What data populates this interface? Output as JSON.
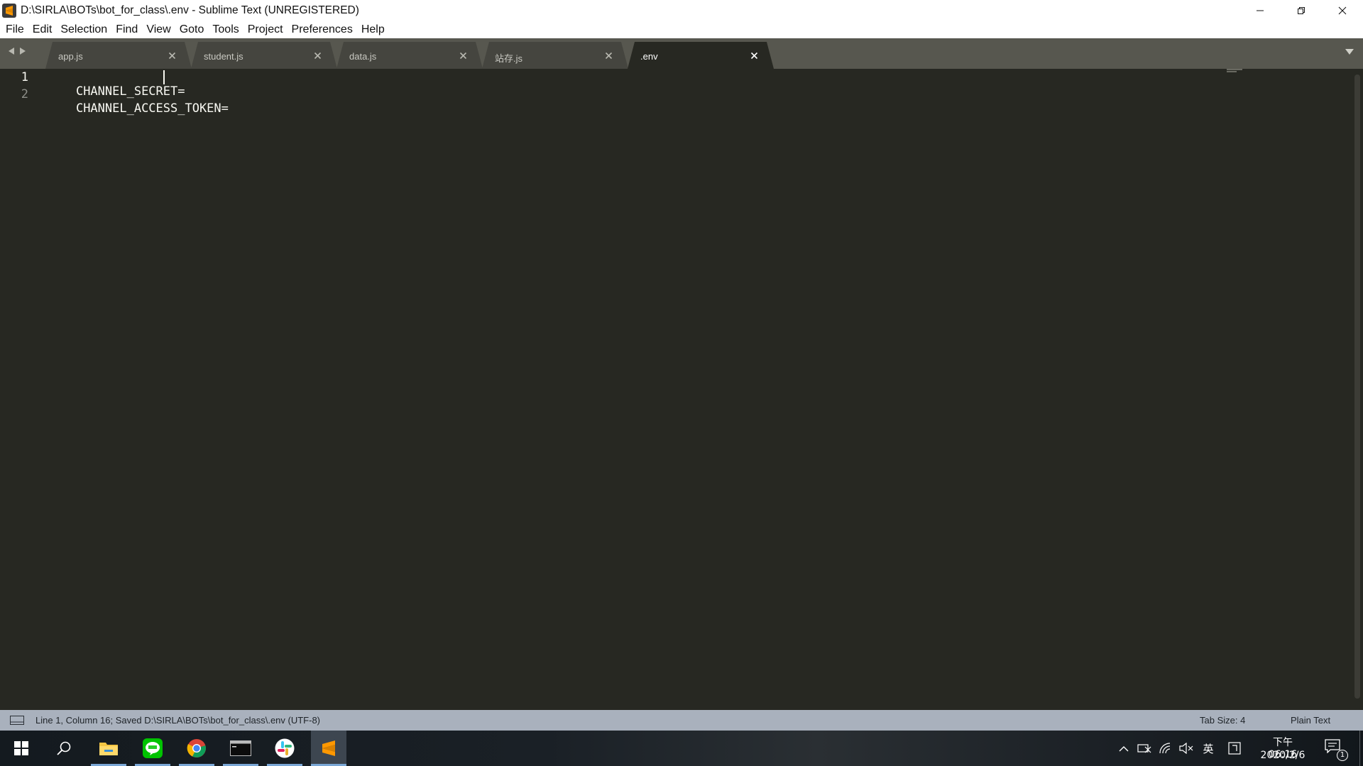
{
  "window": {
    "title": "D:\\SIRLA\\BOTs\\bot_for_class\\.env - Sublime Text (UNREGISTERED)",
    "logo_icon": "sublime-logo-icon",
    "controls": [
      "minimize-icon",
      "restore-icon",
      "close-icon"
    ]
  },
  "menu": {
    "items": [
      "File",
      "Edit",
      "Selection",
      "Find",
      "View",
      "Goto",
      "Tools",
      "Project",
      "Preferences",
      "Help"
    ]
  },
  "tabs": {
    "items": [
      {
        "label": "app.js",
        "active": false
      },
      {
        "label": "student.js",
        "active": false
      },
      {
        "label": "data.js",
        "active": false
      },
      {
        "label": "站存.js",
        "active": false
      },
      {
        "label": ".env",
        "active": true
      }
    ],
    "nav_icons": [
      "tab-scroll-left-icon",
      "tab-scroll-right-icon"
    ],
    "overflow_icon": "tab-list-dropdown-icon"
  },
  "editor": {
    "lines": [
      {
        "number": "1",
        "text": "CHANNEL_SECRET="
      },
      {
        "number": "2",
        "text": "CHANNEL_ACCESS_TOKEN="
      }
    ],
    "cursor": {
      "line": 1,
      "column": 16
    }
  },
  "status": {
    "text": "Line 1, Column 16; Saved D:\\SIRLA\\BOTs\\bot_for_class\\.env (UTF-8)",
    "tab_size": "Tab Size: 4",
    "syntax": "Plain Text"
  },
  "taskbar": {
    "apps": [
      "start-icon",
      "search-icon",
      "file-explorer-icon",
      "line-app-icon",
      "chrome-icon",
      "terminal-icon",
      "slack-icon",
      "sublime-text-icon"
    ],
    "tray": {
      "ime": "英",
      "time": "下午 06:16",
      "date": "2020/2/6",
      "notification_count": "1"
    }
  },
  "colors": {
    "editor_bg": "#272822",
    "tabbar_bg": "#57574f",
    "active_tab_bg": "#272822",
    "statusbar_bg": "#a9b1bd",
    "text": "#f8f8f2"
  }
}
